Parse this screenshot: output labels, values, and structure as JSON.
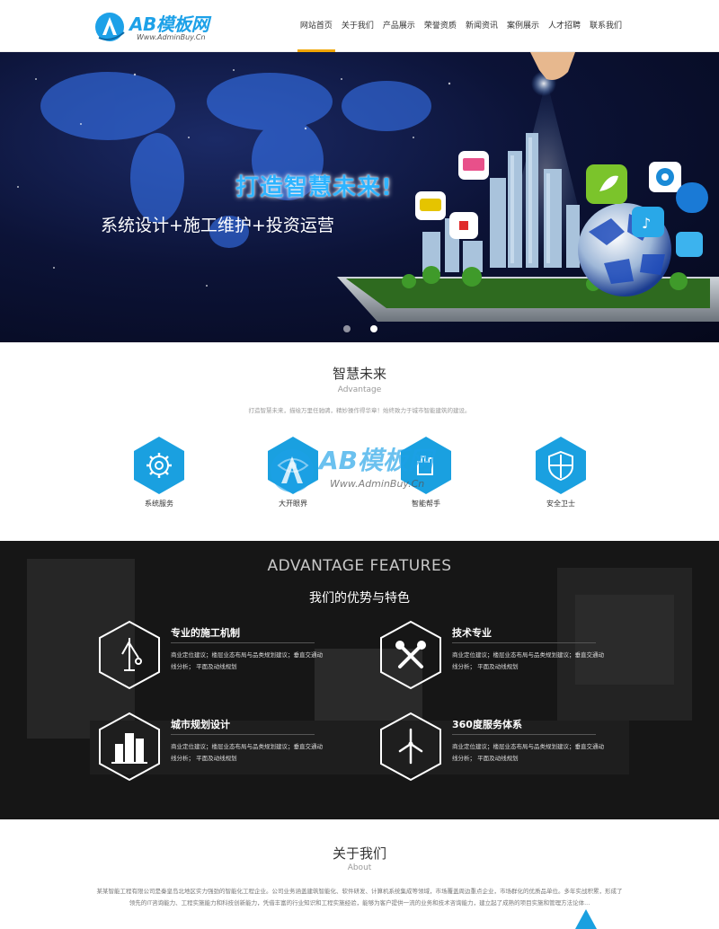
{
  "header": {
    "logo_text": "AB模板网",
    "logo_sub": "Www.AdminBuy.Cn",
    "nav": [
      "网站首页",
      "关于我们",
      "产品展示",
      "荣誉资质",
      "新闻资讯",
      "案例展示",
      "人才招聘",
      "联系我们"
    ],
    "active_index": 0,
    "accent_color": "#f0a500",
    "brand_color": "#1da1e8"
  },
  "banner": {
    "title": "打造智慧未来!",
    "subtitle": "系统设计+施工维护+投资运营",
    "slide_count": 2,
    "active_slide": 0
  },
  "advantage": {
    "title": "智慧未来",
    "subtitle": "Advantage",
    "desc": "打造智慧未来，描绘万里任驰骋，精妙操作得华章！始终致力于城市智能建筑的建设。",
    "services": [
      {
        "label": "系统服务",
        "icon": "gear-icon"
      },
      {
        "label": "大开眼界",
        "icon": "eye-icon"
      },
      {
        "label": "智能帮手",
        "icon": "hand-icon"
      },
      {
        "label": "安全卫士",
        "icon": "shield-icon"
      }
    ],
    "hex_color": "#1aa0e0",
    "watermark_text": "AB模板网",
    "watermark_sub": "Www.AdminBuy.Cn"
  },
  "features": {
    "title": "ADVANTAGE FEATURES",
    "subtitle": "我们的优势与特色",
    "items": [
      {
        "title": "专业的施工机制",
        "icon": "crane-icon",
        "desc": "商业定位建议；楼层业态布局与品类规划建议；垂直交通动线分析； 平面及动线规划"
      },
      {
        "title": "技术专业",
        "icon": "tools-icon",
        "desc": "商业定位建议；楼层业态布局与品类规划建议；垂直交通动线分析； 平面及动线规划"
      },
      {
        "title": "城市规划设计",
        "icon": "buildings-icon",
        "desc": "商业定位建议；楼层业态布局与品类规划建议；垂直交通动线分析； 平面及动线规划"
      },
      {
        "title": "360度服务体系",
        "icon": "windmill-icon",
        "desc": "商业定位建议；楼层业态布局与品类规划建议；垂直交通动线分析； 平面及动线规划"
      }
    ]
  },
  "about": {
    "title": "关于我们",
    "subtitle": "About",
    "text": "某某智能工程有限公司是秦皇岛北地区实力强劲的智能化工程企业。公司业务涵盖建筑智能化、软件研发、计算机系统集成等领域，市场覆盖周边重点企业，市场群化的优质品单位。多年实战积累，形成了领先的IT咨询能力、工程实施能力和科技创新能力，凭借丰富的行业知识和工程实施经验，能够为客户提供一流的业务和技术咨询能力，建立起了成熟的项目实施和管理方法论体..."
  }
}
